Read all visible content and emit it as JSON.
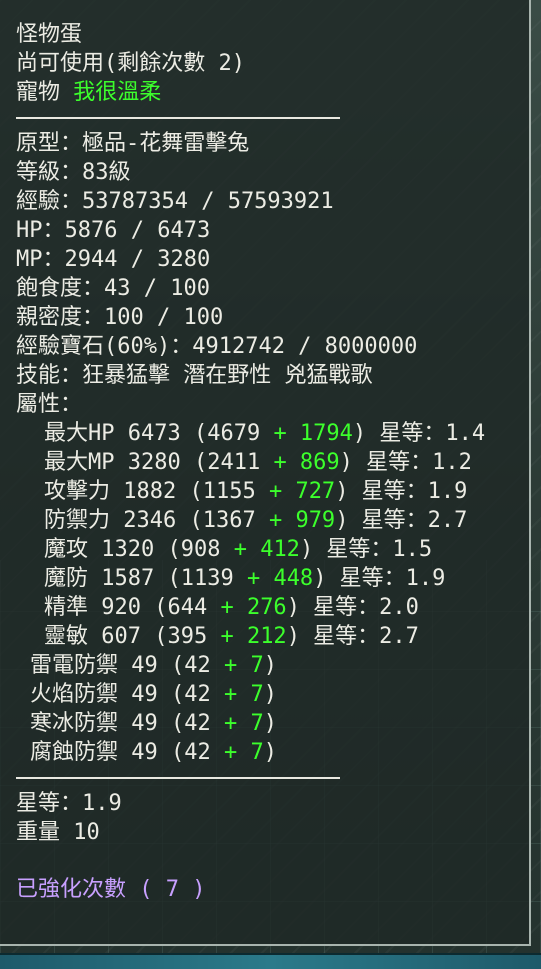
{
  "item": {
    "name": "怪物蛋",
    "usage": "尚可使用(剩餘次數 2)",
    "pet_label": "寵物",
    "pet_name": "我很溫柔"
  },
  "stats": {
    "prototype": "原型：極品-花舞雷擊兔",
    "level": "等級：83級",
    "exp": "經驗：53787354 / 57593921",
    "hp": "HP：5876 / 6473",
    "mp": "MP：2944 / 3280",
    "satiety": "飽食度：43 / 100",
    "intimacy": "親密度：100 / 100",
    "exp_gem": "經驗寶石(60%)：4912742 / 8000000",
    "skills": "技能：狂暴猛擊 潛在野性 兇猛戰歌",
    "attributes_label": "屬性："
  },
  "attributes": [
    {
      "pre": "最大HP 6473 (4679 ",
      "bonus": "+ 1794",
      "post": ") 星等：1.4"
    },
    {
      "pre": "最大MP 3280 (2411 ",
      "bonus": "+ 869",
      "post": ") 星等：1.2"
    },
    {
      "pre": "攻擊力 1882 (1155 ",
      "bonus": "+ 727",
      "post": ") 星等：1.9"
    },
    {
      "pre": "防禦力 2346 (1367 ",
      "bonus": "+ 979",
      "post": ") 星等：2.7"
    },
    {
      "pre": "魔攻 1320 (908 ",
      "bonus": "+ 412",
      "post": ") 星等：1.5"
    },
    {
      "pre": "魔防 1587 (1139 ",
      "bonus": "+ 448",
      "post": ") 星等：1.9"
    },
    {
      "pre": "精準 920 (644 ",
      "bonus": "+ 276",
      "post": ") 星等：2.0"
    },
    {
      "pre": "靈敏 607 (395 ",
      "bonus": "+ 212",
      "post": ") 星等：2.7"
    }
  ],
  "resistances": [
    {
      "pre": "雷電防禦 49 (42 ",
      "bonus": "+ 7",
      "post": ")"
    },
    {
      "pre": "火焰防禦 49 (42 ",
      "bonus": "+ 7",
      "post": ")"
    },
    {
      "pre": "寒冰防禦 49 (42 ",
      "bonus": "+ 7",
      "post": ")"
    },
    {
      "pre": "腐蝕防禦 49 (42 ",
      "bonus": "+ 7",
      "post": ")"
    }
  ],
  "footer": {
    "star_rank": "星等：1.9",
    "weight": "重量 10",
    "enhance_count": "已強化次數 ( 7 )"
  },
  "colors": {
    "text": "#ecece4",
    "bonus": "#3cff2c",
    "enhance": "#c8a0ff",
    "panel": "#1e2826"
  }
}
